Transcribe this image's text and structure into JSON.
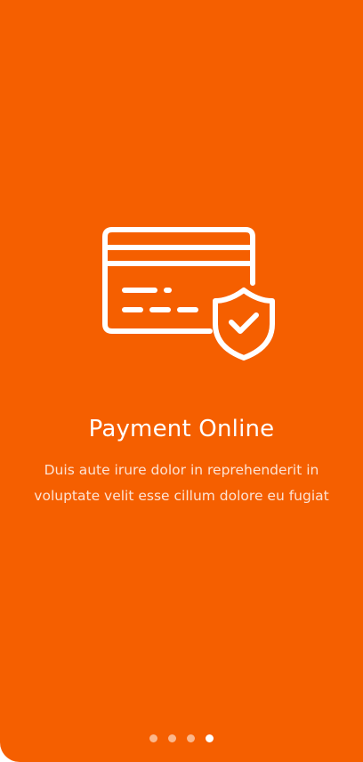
{
  "slide": {
    "icon": "credit-card-shield-check-icon",
    "title": "Payment Online",
    "description_line1": "Duis aute irure dolor in reprehenderit in",
    "description_line2": "voluptate velit esse cillum dolore eu fugiat"
  },
  "pager": {
    "total": 4,
    "active_index": 4
  },
  "colors": {
    "background": "#f55f00",
    "foreground": "#ffffff"
  }
}
